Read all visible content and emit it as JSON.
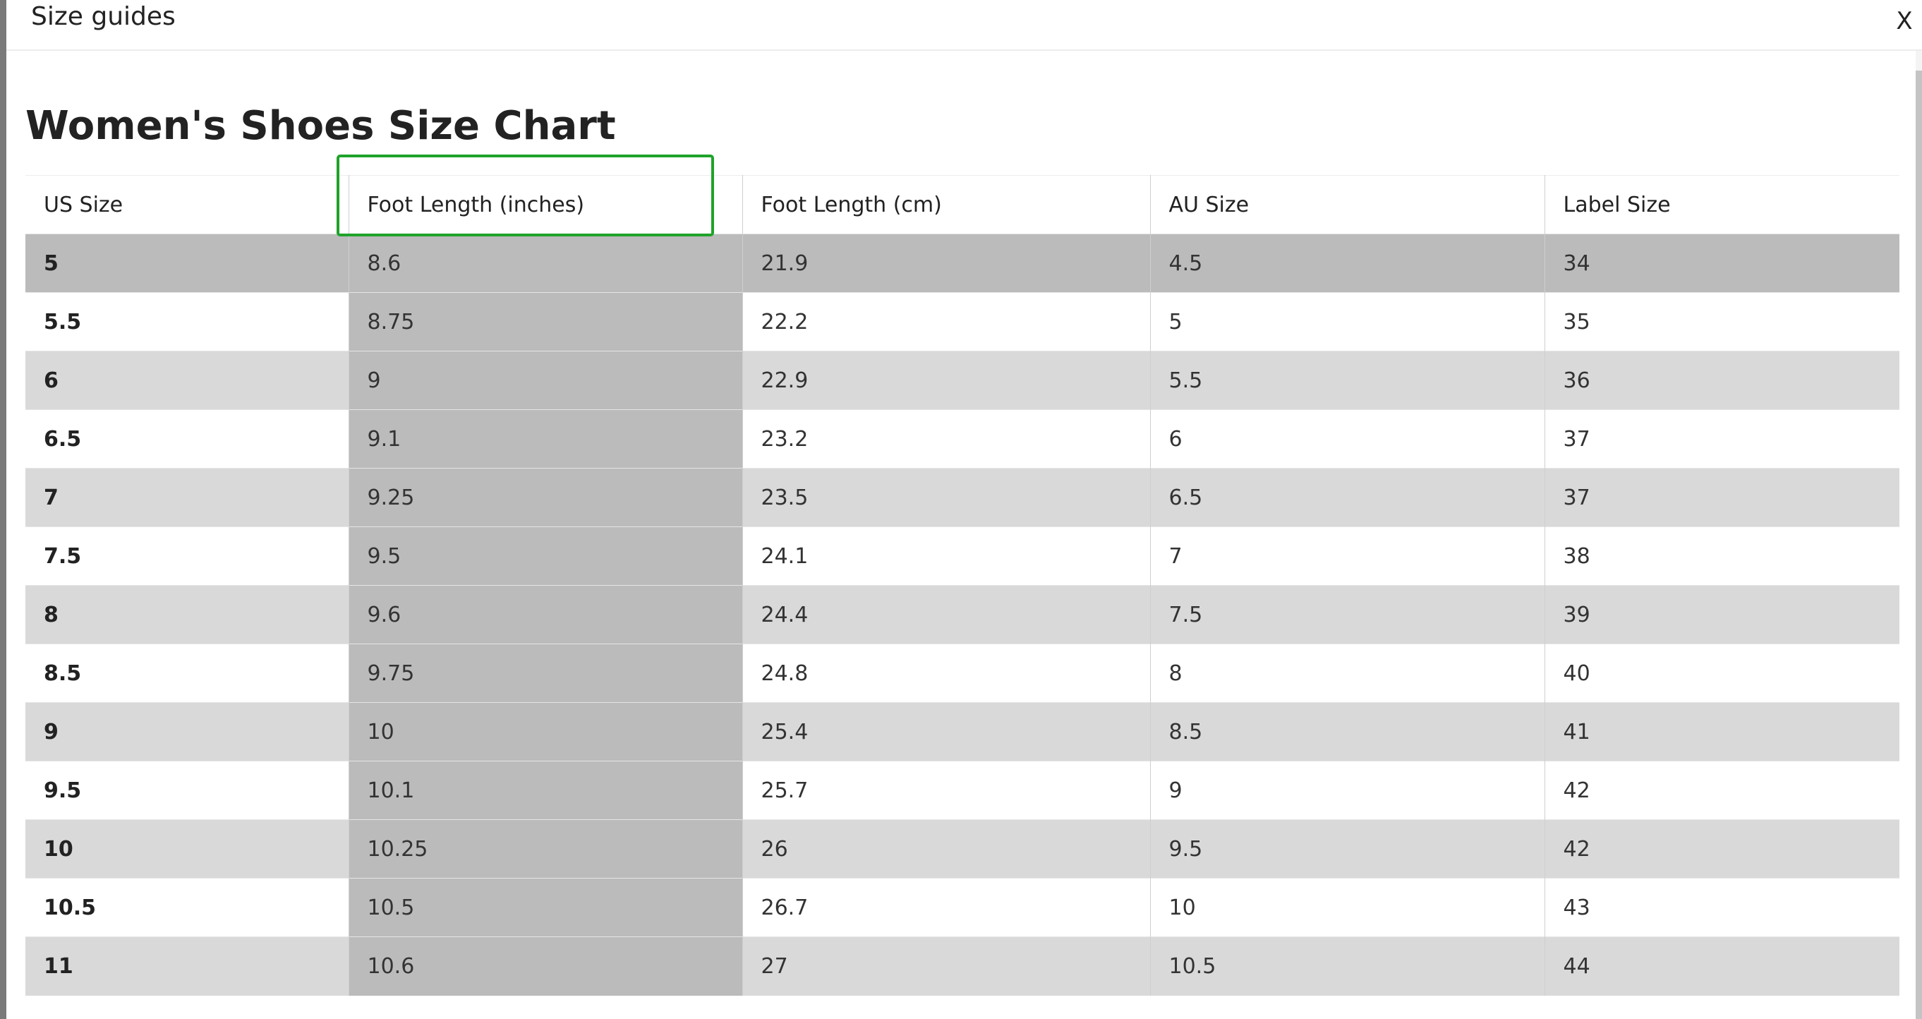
{
  "modal": {
    "title": "Size guides",
    "close_label": "X"
  },
  "size_chart": {
    "title": "Women's Shoes Size Chart",
    "columns": [
      "US Size",
      "Foot Length (inches)",
      "Foot Length (cm)",
      "AU Size",
      "Label Size"
    ],
    "rows": [
      [
        "5",
        "8.6",
        "21.9",
        "4.5",
        "34"
      ],
      [
        "5.5",
        "8.75",
        "22.2",
        "5",
        "35"
      ],
      [
        "6",
        "9",
        "22.9",
        "5.5",
        "36"
      ],
      [
        "6.5",
        "9.1",
        "23.2",
        "6",
        "37"
      ],
      [
        "7",
        "9.25",
        "23.5",
        "6.5",
        "37"
      ],
      [
        "7.5",
        "9.5",
        "24.1",
        "7",
        "38"
      ],
      [
        "8",
        "9.6",
        "24.4",
        "7.5",
        "39"
      ],
      [
        "8.5",
        "9.75",
        "24.8",
        "8",
        "40"
      ],
      [
        "9",
        "10",
        "25.4",
        "8.5",
        "41"
      ],
      [
        "9.5",
        "10.1",
        "25.7",
        "9",
        "42"
      ],
      [
        "10",
        "10.25",
        "26",
        "9.5",
        "42"
      ],
      [
        "10.5",
        "10.5",
        "26.7",
        "10",
        "43"
      ],
      [
        "11",
        "10.6",
        "27",
        "10.5",
        "44"
      ]
    ],
    "highlighted_column": "Foot Length (inches)"
  },
  "colors": {
    "highlight_border": "#1fa32a",
    "row_shaded": "#d9d9d9",
    "column_hover": "#bbbbbb"
  }
}
